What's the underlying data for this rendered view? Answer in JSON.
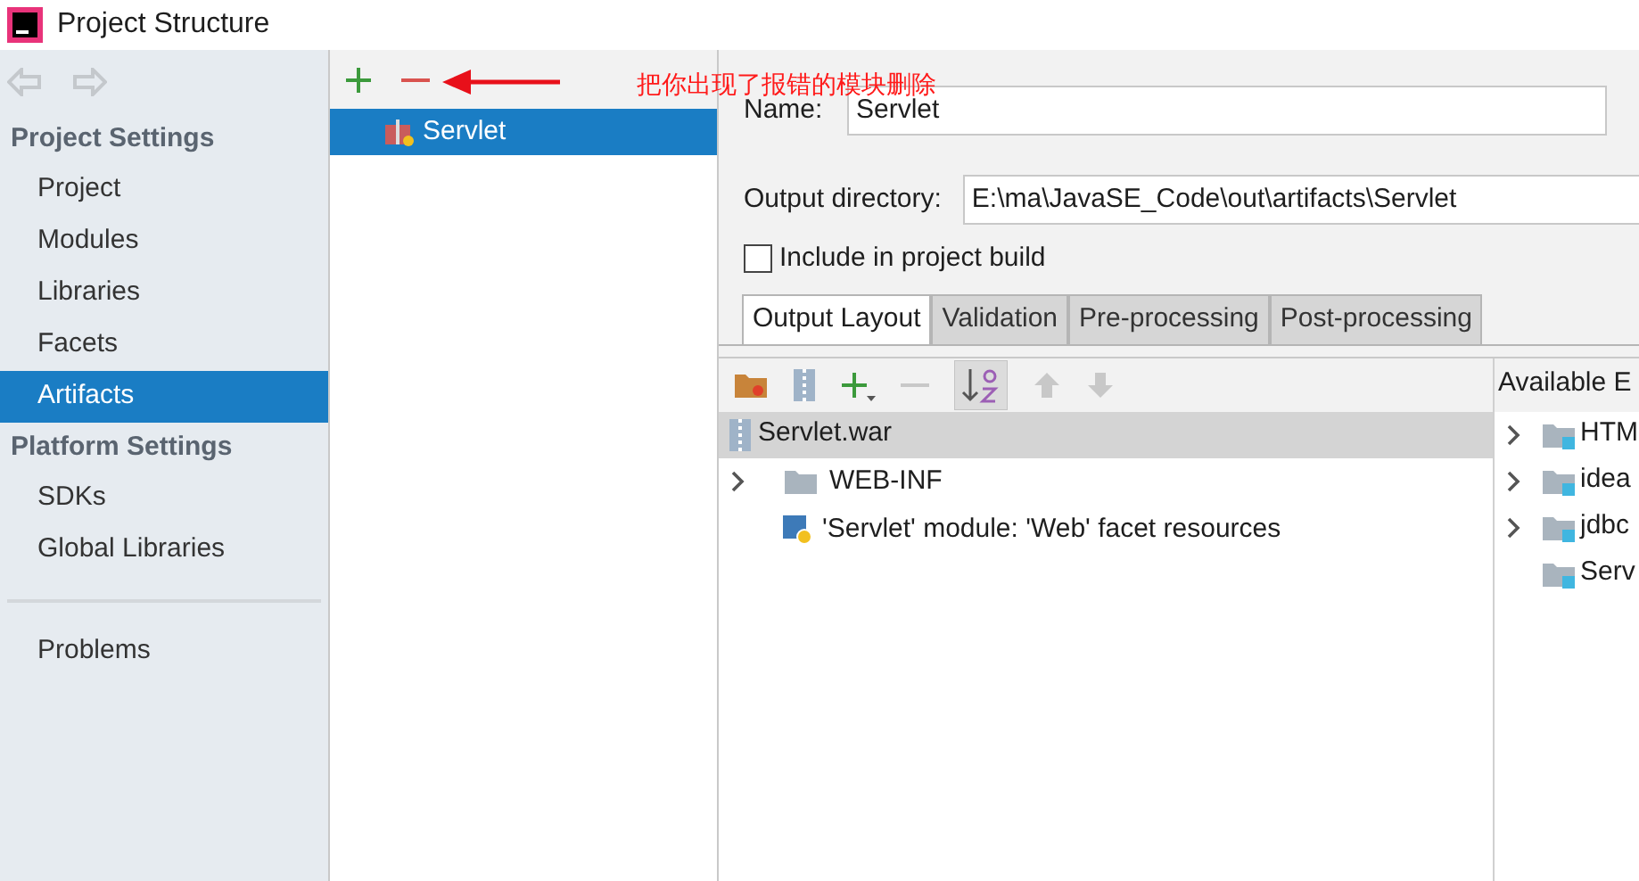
{
  "window": {
    "title": "Project Structure"
  },
  "sidebar": {
    "sections": [
      {
        "title": "Project Settings",
        "items": [
          {
            "label": "Project",
            "selected": false
          },
          {
            "label": "Modules",
            "selected": false
          },
          {
            "label": "Libraries",
            "selected": false
          },
          {
            "label": "Facets",
            "selected": false
          },
          {
            "label": "Artifacts",
            "selected": true
          }
        ]
      },
      {
        "title": "Platform Settings",
        "items": [
          {
            "label": "SDKs",
            "selected": false
          },
          {
            "label": "Global Libraries",
            "selected": false
          }
        ]
      }
    ],
    "bottom_items": [
      {
        "label": "Problems",
        "selected": false
      }
    ]
  },
  "artifacts": [
    {
      "label": "Servlet",
      "selected": true
    }
  ],
  "annotation": {
    "text": "把你出现了报错的模块删除"
  },
  "form": {
    "name_label": "Name:",
    "name_value": "Servlet",
    "output_label": "Output directory:",
    "output_value": "E:\\ma\\JavaSE_Code\\out\\artifacts\\Servlet",
    "include_label": "Include in project build",
    "include_checked": false
  },
  "tabs": [
    {
      "label": "Output Layout",
      "selected": true
    },
    {
      "label": "Validation",
      "selected": false
    },
    {
      "label": "Pre-processing",
      "selected": false
    },
    {
      "label": "Post-processing",
      "selected": false
    }
  ],
  "layout_tree": [
    {
      "label": "Servlet.war",
      "kind": "archive",
      "selected": true,
      "children": [
        {
          "label": "WEB-INF",
          "kind": "folder",
          "selected": false,
          "expanded": false
        },
        {
          "label": "'Servlet' module: 'Web' facet resources",
          "kind": "facet",
          "selected": false
        }
      ]
    }
  ],
  "available": {
    "title": "Available E",
    "items": [
      {
        "label": "HTM",
        "expandable": true
      },
      {
        "label": "idea",
        "expandable": true
      },
      {
        "label": "jdbc",
        "expandable": true
      },
      {
        "label": "Serv",
        "expandable": false
      }
    ]
  }
}
